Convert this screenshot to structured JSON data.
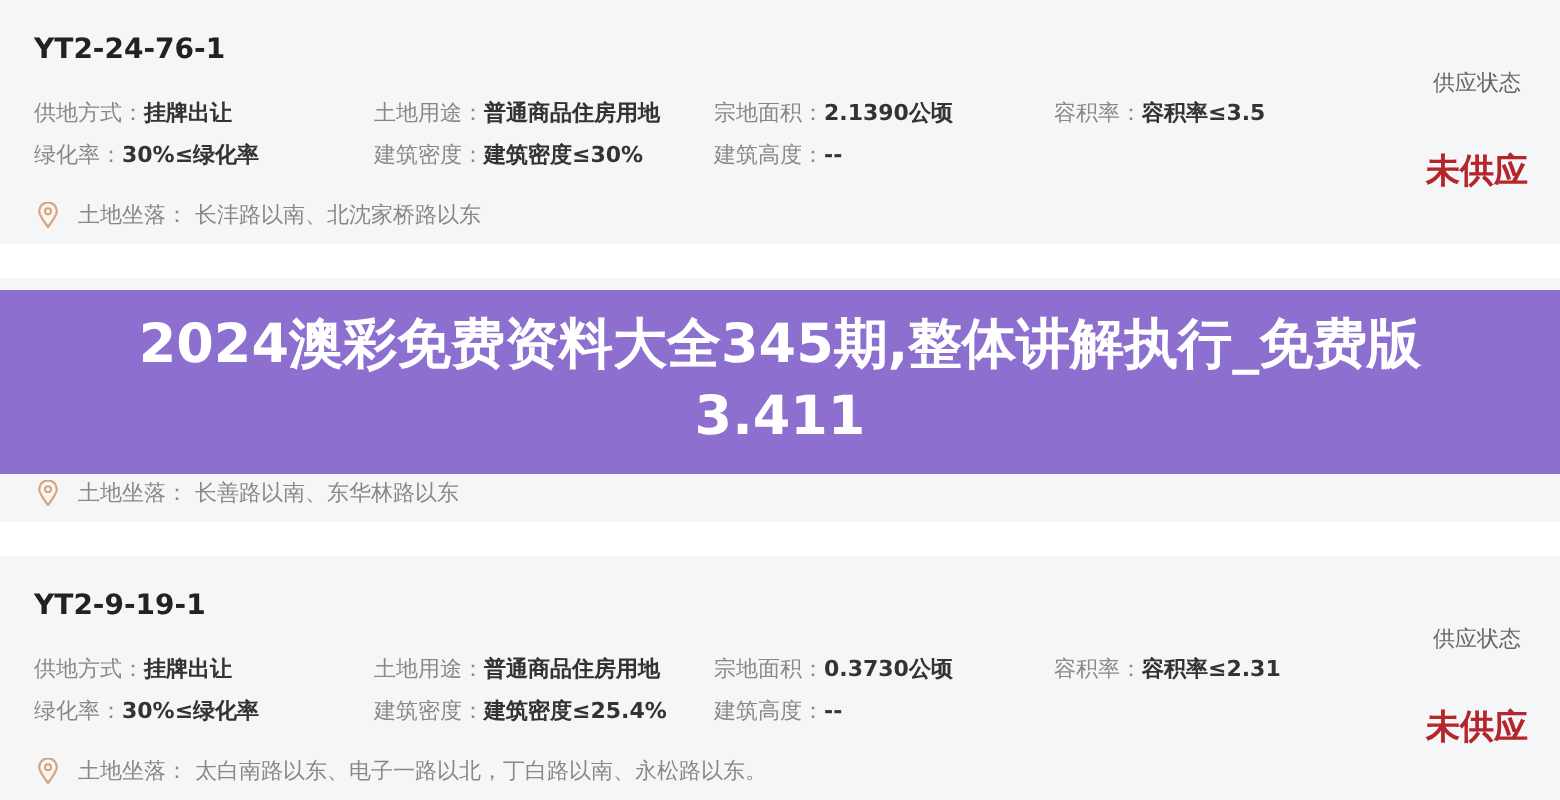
{
  "listings": [
    {
      "code": "YT2-24-76-1",
      "status_label": "供应状态",
      "status": "未供应",
      "rows": [
        [
          {
            "label": "供地方式：",
            "value": "挂牌出让"
          },
          {
            "label": "土地用途：",
            "value": "普通商品住房用地"
          },
          {
            "label": "宗地面积：",
            "value": "2.1390公顷"
          },
          {
            "label": "容积率：",
            "value": "容积率≤3.5"
          }
        ],
        [
          {
            "label": "绿化率：",
            "value": "30%≤绿化率"
          },
          {
            "label": "建筑密度：",
            "value": "建筑密度≤30%"
          },
          {
            "label": "建筑高度：",
            "value": "--"
          }
        ]
      ],
      "location_label": "土地坐落：",
      "location": "长沣路以南、北沈家桥路以东"
    },
    {
      "location_label": "土地坐落：",
      "location": "长善路以南、东华林路以东"
    },
    {
      "code": "YT2-9-19-1",
      "status_label": "供应状态",
      "status": "未供应",
      "rows": [
        [
          {
            "label": "供地方式：",
            "value": "挂牌出让"
          },
          {
            "label": "土地用途：",
            "value": "普通商品住房用地"
          },
          {
            "label": "宗地面积：",
            "value": "0.3730公顷"
          },
          {
            "label": "容积率：",
            "value": "容积率≤2.31"
          }
        ],
        [
          {
            "label": "绿化率：",
            "value": "30%≤绿化率"
          },
          {
            "label": "建筑密度：",
            "value": "建筑密度≤25.4%"
          },
          {
            "label": "建筑高度：",
            "value": "--"
          }
        ]
      ],
      "location_label": "土地坐落：",
      "location": "太白南路以东、电子一路以北，丁白路以南、永松路以东。"
    }
  ],
  "banner": {
    "title": "2024澳彩免费资料大全345期,整体讲解执行_免费版3.411"
  }
}
